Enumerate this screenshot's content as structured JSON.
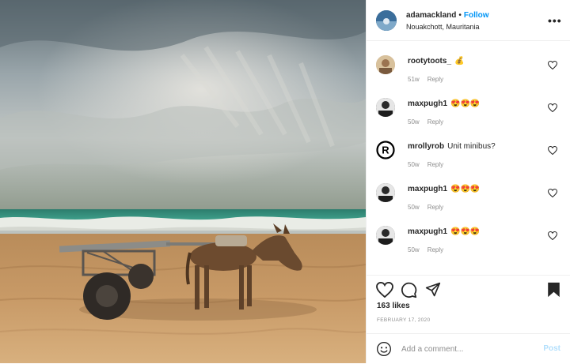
{
  "post": {
    "author": "adamackland",
    "follow_label": "Follow",
    "location": "Nouakchott, Mauritania",
    "more_label": "•••"
  },
  "comments": [
    {
      "user": "rootytoots_",
      "text": "💰",
      "age": "51w",
      "reply": "Reply",
      "avatar_color": "#c9a77c"
    },
    {
      "user": "maxpugh1",
      "text": "😍😍😍",
      "age": "50w",
      "reply": "Reply",
      "avatar_color": "#3a3a3a"
    },
    {
      "user": "mrollyrob",
      "text": "Unit minibus?",
      "age": "50w",
      "reply": "Reply",
      "avatar_color": "#000000"
    },
    {
      "user": "maxpugh1",
      "text": "😍😍😍",
      "age": "50w",
      "reply": "Reply",
      "avatar_color": "#3a3a3a"
    },
    {
      "user": "maxpugh1",
      "text": "😍😍😍",
      "age": "50w",
      "reply": "Reply",
      "avatar_color": "#3a3a3a"
    }
  ],
  "likes_label": "163 likes",
  "date_label": "FEBRUARY 17, 2020",
  "comment_box": {
    "placeholder": "Add a comment...",
    "post_label": "Post"
  },
  "registered_mark": "®",
  "colors": {
    "follow": "#0095f6",
    "post_disabled": "#b2dffc",
    "muted": "#8e8e8e"
  },
  "icons": [
    "heart-icon",
    "comment-icon",
    "share-icon",
    "bookmark-icon",
    "emoji-icon",
    "more-icon"
  ]
}
